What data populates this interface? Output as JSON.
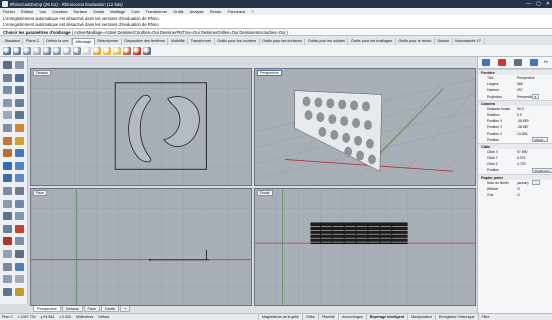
{
  "window": {
    "title": "RhinoCastDump (25 Ko) - Rhinoceros Évaluation (12 bits)",
    "controls": [
      "—",
      "▢",
      "✕"
    ]
  },
  "menu": [
    "Fichier",
    "Édition",
    "Vue",
    "Courbes",
    "Surface",
    "Solide",
    "Maillage",
    "Cote",
    "Transformer",
    "Outils",
    "Analyse",
    "Rendu",
    "Panneaux",
    "?"
  ],
  "command_history": [
    "L'enregistrement automatique est désactivé dans les versions d'évaluation de Rhino.",
    "L'enregistrement automatique est désactivé dans les versions d'évaluation de Rhino"
  ],
  "command_prompt": {
    "label": "Choisir les paramètres d'ombrage",
    "options": "( ActiverMaillage=Activé DessinerCourbes=Oui DessinerPtsTrav=Oui DessinerGrilles=Oui DessinerIsocourbes=Oui )"
  },
  "toolbar_tabs": [
    "Standard",
    "Plans C.",
    "Définir la vue",
    "Affichage",
    "Sélectionner",
    "Disposition des fenêtres",
    "Visibilité",
    "Transformer",
    "Outils pour les courbes",
    "Outils pour les surfaces",
    "Outils pour les solides",
    "Outils pour les maillages",
    "Outils pour le rendu",
    "Dessin",
    "Nouveautés V7"
  ],
  "active_toolbar_tab": 3,
  "toolbar_icons": [
    {
      "name": "wireframe-sphere-icon",
      "color": "#4e6e96"
    },
    {
      "name": "shaded-sphere-icon",
      "color": "#5c7fa9"
    },
    {
      "name": "rendered-sphere-icon",
      "color": "#7b8fa8"
    },
    {
      "name": "ghosted-sphere-icon",
      "color": "#9aa9b8"
    },
    {
      "name": "xray-sphere-icon",
      "color": "#6c87a6"
    },
    {
      "name": "technical-sphere-icon",
      "color": "#8694a4"
    },
    {
      "name": "artistic-sphere-icon",
      "color": "#a8b2bd"
    },
    {
      "name": "pen-sphere-icon",
      "color": "#7d8a98"
    },
    {
      "name": "arctic-sphere-icon",
      "color": "#c3ccd6"
    },
    {
      "name": "raytraced-sphere-icon",
      "color": "#e0a52c"
    },
    {
      "name": "sun-icon",
      "color": "#e5b83b"
    },
    {
      "name": "light-bulb-icon",
      "color": "#d9c048"
    },
    {
      "name": "material-icon",
      "color": "#c45a3c"
    },
    {
      "name": "close-red-x-icon",
      "color": "#d62d20"
    },
    {
      "name": "image-frame-icon",
      "color": "#5f6c7a"
    }
  ],
  "left_tools": [
    {
      "name": "select-arrow-icon",
      "color": "#5f6d7f"
    },
    {
      "name": "point-icon",
      "color": "#8a97a6"
    },
    {
      "name": "polyline-icon",
      "color": "#6e8299"
    },
    {
      "name": "curve-icon",
      "color": "#4f6f94"
    },
    {
      "name": "circle-icon",
      "color": "#7290b0"
    },
    {
      "name": "arc-icon",
      "color": "#5b7a9d"
    },
    {
      "name": "rectangle-icon",
      "color": "#8799ad"
    },
    {
      "name": "polygon-icon",
      "color": "#6a7f96"
    },
    {
      "name": "ellipse-icon",
      "color": "#9aa9b8"
    },
    {
      "name": "fillet-icon",
      "color": "#5e7590"
    },
    {
      "name": "offset-curve-icon",
      "color": "#7c90a6"
    },
    {
      "name": "surface-corner-icon",
      "color": "#d1862e"
    },
    {
      "name": "extrude-icon",
      "color": "#c4782a"
    },
    {
      "name": "loft-icon",
      "color": "#d4a02d"
    },
    {
      "name": "sweep-icon",
      "color": "#b86f2a"
    },
    {
      "name": "solid-box-icon",
      "color": "#3f78c0"
    },
    {
      "name": "solid-sphere-icon",
      "color": "#2c6fb8"
    },
    {
      "name": "cylinder-icon",
      "color": "#4c86c8"
    },
    {
      "name": "boolean-union-icon",
      "color": "#3d6da8"
    },
    {
      "name": "boolean-diff-icon",
      "color": "#5a8bc4"
    },
    {
      "name": "mesh-icon",
      "color": "#7a8da3"
    },
    {
      "name": "move-icon",
      "color": "#6b7d91"
    },
    {
      "name": "copy-icon",
      "color": "#8b9caf"
    },
    {
      "name": "rotate-icon",
      "color": "#6f8aa8"
    },
    {
      "name": "scale-icon",
      "color": "#5d7591"
    },
    {
      "name": "mirror-icon",
      "color": "#8094aa"
    },
    {
      "name": "array-icon",
      "color": "#6a819b"
    },
    {
      "name": "trim-icon",
      "color": "#c8402f"
    },
    {
      "name": "split-icon",
      "color": "#a8382b"
    },
    {
      "name": "join-icon",
      "color": "#7f90a4"
    },
    {
      "name": "explode-icon",
      "color": "#94a3b3"
    },
    {
      "name": "text-icon",
      "color": "#5c6e83"
    },
    {
      "name": "dimension-icon",
      "color": "#7a8a9c"
    },
    {
      "name": "layer-icon",
      "color": "#4d7fb8"
    },
    {
      "name": "hide-icon",
      "color": "#8e9db0"
    },
    {
      "name": "lock-icon",
      "color": "#a0adbb"
    },
    {
      "name": "properties-icon",
      "color": "#5f758e"
    },
    {
      "name": "render-icon",
      "color": "#c89a2c"
    }
  ],
  "viewports": {
    "top": "Dessus",
    "perspective": "Perspective",
    "front": "Face",
    "right": "Droite"
  },
  "viewport_tabs": [
    "Perspective",
    "Dessus",
    "Face",
    "Droite",
    "+"
  ],
  "active_viewport_tab": 0,
  "status": {
    "plane": "Plan C",
    "x": "x 1057.734",
    "y": "y 94.564",
    "z": "z 0.000",
    "units": "Millimètres",
    "layer": "Défaut",
    "toggles": [
      "Magnétisme de la grille",
      "Ortho",
      "Planéité",
      "Accrochages",
      "Repérage intelligent",
      "Manipulateur",
      "Enregistrer l'historique",
      "Filtre"
    ],
    "active_toggles": [
      4
    ]
  },
  "panel": {
    "tab_icons": [
      {
        "name": "properties-tab-icon",
        "color": "#3a78c2"
      },
      {
        "name": "layers-tab-icon",
        "color": "#c93b2b"
      },
      {
        "name": "display-tab-icon",
        "color": "#5b6f86"
      },
      {
        "name": "help-tab-icon",
        "color": "#3a78c2"
      }
    ],
    "tab_label": "Fe",
    "sections": [
      {
        "title": "Fenêtre",
        "rows": [
          {
            "k": "Titre",
            "v": "Perspective"
          },
          {
            "k": "Largeur",
            "v": "566"
          },
          {
            "k": "Hauteur",
            "v": "297"
          },
          {
            "k": "Projection",
            "v": "Perspective",
            "btn": "▾"
          }
        ]
      },
      {
        "title": "Caméra",
        "rows": [
          {
            "k": "Distance focale",
            "v": "50.0"
          },
          {
            "k": "Rotation",
            "v": "0.0"
          },
          {
            "k": "Position X",
            "v": "-36.853"
          },
          {
            "k": "Position Y",
            "v": "-28.587"
          },
          {
            "k": "Position Z",
            "v": "13.363"
          },
          {
            "k": "Position",
            "v": "",
            "btn": "Placer..."
          }
        ]
      },
      {
        "title": "Cible",
        "rows": [
          {
            "k": "Cible X",
            "v": "97.590"
          },
          {
            "k": "Cible Y",
            "v": "8.074"
          },
          {
            "k": "Cible Z",
            "v": "4.729"
          },
          {
            "k": "Position",
            "v": "",
            "btn": "Positionner..."
          }
        ]
      },
      {
        "title": "Papier peint",
        "rows": [
          {
            "k": "Nom du fichier",
            "v": "(aucun)",
            "btn": "…"
          },
          {
            "k": "Afficher",
            "v": "☑"
          },
          {
            "k": "Gris",
            "v": "☑"
          }
        ]
      }
    ]
  }
}
